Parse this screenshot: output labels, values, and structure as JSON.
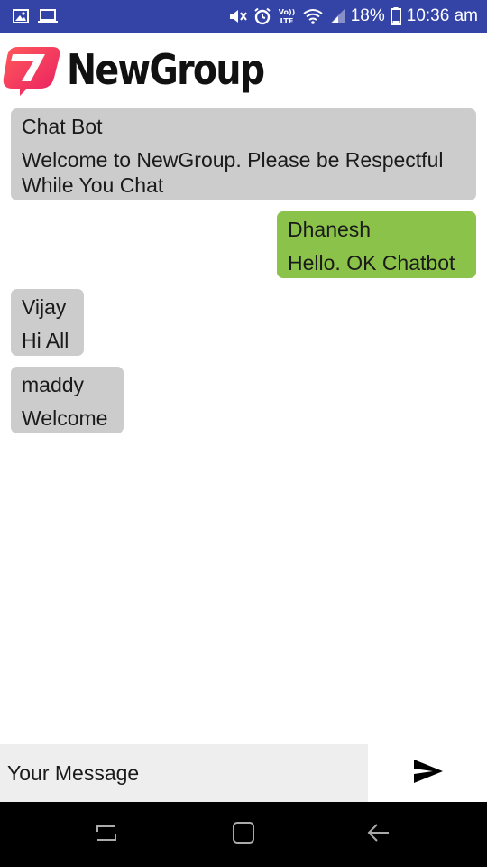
{
  "status_bar": {
    "battery": "18%",
    "time": "10:36 am",
    "network_label": "VoLTE",
    "icons": [
      "image-icon",
      "laptop-icon",
      "mute-icon",
      "alarm-icon",
      "volte-icon",
      "wifi-icon",
      "signal-icon",
      "battery-icon"
    ],
    "background": "#3343a6"
  },
  "header": {
    "title": "NewGroup",
    "logo_icon": "newgroup-logo-icon"
  },
  "messages": [
    {
      "sender": "Chat Bot",
      "text": "Welcome to NewGroup. Please be Respectful While You Chat",
      "direction": "incoming"
    },
    {
      "sender": "Dhanesh",
      "text": "Hello. OK Chatbot",
      "direction": "outgoing"
    },
    {
      "sender": "Vijay",
      "text": "Hi All",
      "direction": "incoming"
    },
    {
      "sender": "maddy",
      "text": "Welcome",
      "direction": "incoming"
    }
  ],
  "composer": {
    "placeholder": "Your Message",
    "send_icon": "send-icon"
  },
  "colors": {
    "incoming_bubble": "#cccccc",
    "outgoing_bubble": "#8bc34a",
    "input_background": "#eeeeee",
    "logo_accent": "#e91e63"
  },
  "nav_bar": {
    "icons": [
      "recent-apps-icon",
      "home-icon",
      "back-icon"
    ]
  }
}
